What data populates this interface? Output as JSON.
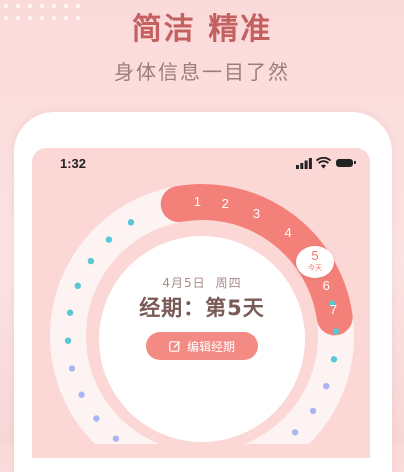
{
  "promo": {
    "headline": "简洁 精准",
    "subline": "身体信息一目了然"
  },
  "status_bar": {
    "time": "1:32",
    "icons": [
      "signal-icon",
      "wifi-icon",
      "battery-icon"
    ]
  },
  "cycle": {
    "date": "4月5日",
    "weekday": "周四",
    "status": "经期：第5天",
    "edit_label": "编辑经期",
    "period_days": [
      "1",
      "2",
      "3",
      "4",
      "5",
      "6",
      "7"
    ],
    "today_day": "5",
    "today_label": "今天"
  },
  "colors": {
    "accent": "#f38a84",
    "period_arc": "#f4807a",
    "fertile_dot": "#58c8d4",
    "safe_dot": "#a9b6f2",
    "ovulation_dot": "#f2b25b",
    "headline": "#c4605f"
  }
}
